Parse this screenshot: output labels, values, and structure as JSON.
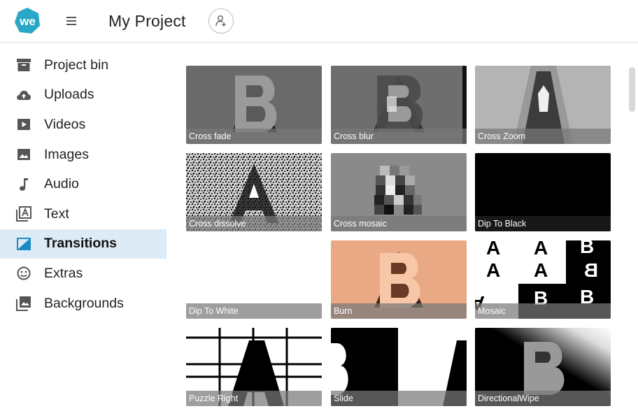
{
  "header": {
    "logo_text": "we",
    "title": "My Project",
    "brand_color": "#29a7c6",
    "menu_icon": "hamburger-icon",
    "add_collaborator_icon": "add-user-icon"
  },
  "sidebar": {
    "active_index": 5,
    "active_color": "#dcebf5",
    "items": [
      {
        "label": "Project bin",
        "icon": "archive-box-icon"
      },
      {
        "label": "Uploads",
        "icon": "cloud-upload-icon"
      },
      {
        "label": "Videos",
        "icon": "video-play-icon"
      },
      {
        "label": "Images",
        "icon": "image-icon"
      },
      {
        "label": "Audio",
        "icon": "music-note-icon"
      },
      {
        "label": "Text",
        "icon": "text-icon"
      },
      {
        "label": "Transitions",
        "icon": "transition-icon"
      },
      {
        "label": "Extras",
        "icon": "smiley-icon"
      },
      {
        "label": "Backgrounds",
        "icon": "background-icon"
      }
    ]
  },
  "transitions": [
    {
      "label": "Cross fade"
    },
    {
      "label": "Cross blur"
    },
    {
      "label": "Cross Zoom"
    },
    {
      "label": "Cross dissolve"
    },
    {
      "label": "Cross mosaic"
    },
    {
      "label": "Dip To Black"
    },
    {
      "label": "Dip To White"
    },
    {
      "label": "Burn"
    },
    {
      "label": "Mosaic"
    },
    {
      "label": "Puzzle Right"
    },
    {
      "label": "Slide"
    },
    {
      "label": "DirectionalWipe"
    }
  ]
}
